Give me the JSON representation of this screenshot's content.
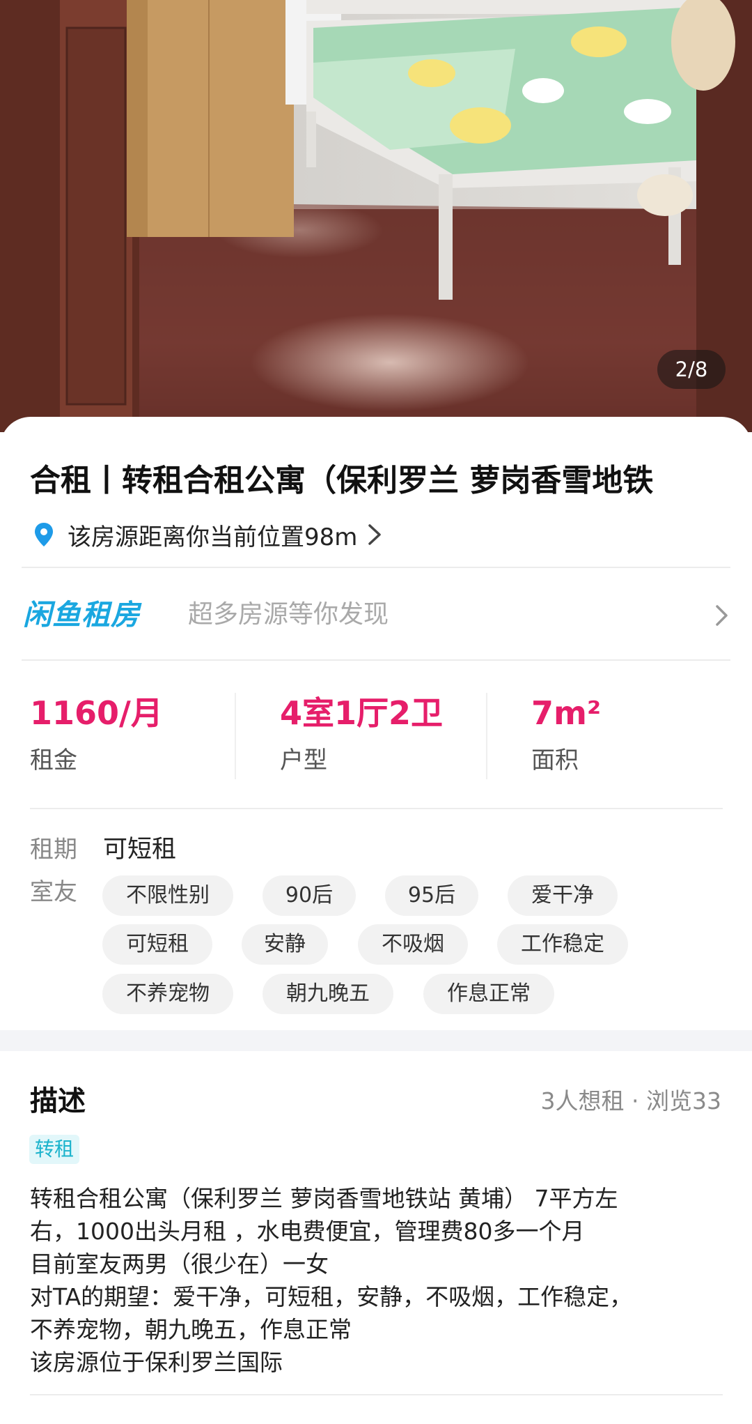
{
  "gallery": {
    "counter": "2/8"
  },
  "listing": {
    "title": "合租丨转租合租公寓（保利罗兰 萝岗香雪地铁",
    "location_text": "该房源距离你当前位置98m"
  },
  "banner": {
    "logo_text": "闲鱼租房",
    "slogan": "超多房源等你发现"
  },
  "stats": [
    {
      "value": "1160/月",
      "label": "租金"
    },
    {
      "value": "4室1厅2卫",
      "label": "户型"
    },
    {
      "value": "7m²",
      "label": "面积"
    }
  ],
  "details": {
    "lease_label": "租期",
    "lease_value": "可短租",
    "roommate_label": "室友",
    "tags": [
      "不限性别",
      "90后",
      "95后",
      "爱干净",
      "可短租",
      "安静",
      "不吸烟",
      "工作稳定",
      "不养宠物",
      "朝九晚五",
      "作息正常"
    ]
  },
  "description": {
    "heading": "描述",
    "meta": "3人想租 · 浏览33",
    "badge": "转租",
    "lines": [
      "转租合租公寓（保利罗兰 萝岗香雪地铁站 黄埔） 7平方左",
      "右，1000出头月租 ，水电费便宜，管理费80多一个月",
      "目前室友两男（很少在）一女",
      "对TA的期望：爱干净，可短租，安静，不吸烟，工作稳定，",
      "不养宠物，朝九晚五，作息正常",
      "该房源位于保利罗兰国际"
    ]
  },
  "colors": {
    "accent_price": "#e61e6a",
    "brand_blue": "#1aa7e0",
    "location_pin": "#1e9be8",
    "badge_text": "#1bb3cc"
  },
  "icons": [
    "location-pin-icon",
    "chevron-right-icon"
  ]
}
